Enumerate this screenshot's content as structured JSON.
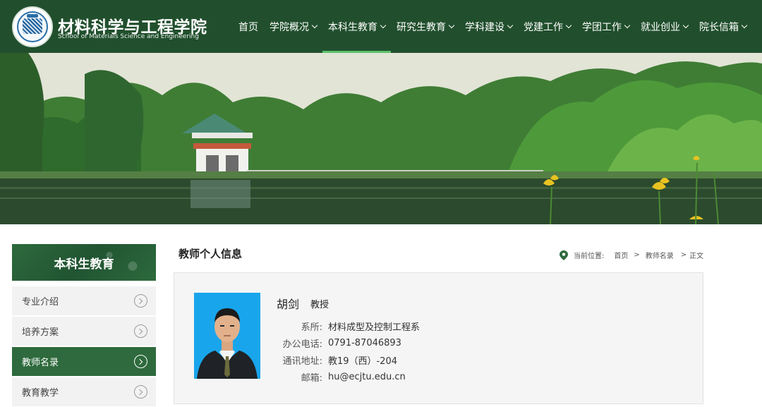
{
  "header": {
    "school_cn": "材料科学与工程学院",
    "school_en": "School of Materials Science and Engineering",
    "nav": [
      {
        "label": "首页",
        "has_dropdown": false,
        "active": false
      },
      {
        "label": "学院概况",
        "has_dropdown": true,
        "active": false
      },
      {
        "label": "本科生教育",
        "has_dropdown": true,
        "active": true
      },
      {
        "label": "研究生教育",
        "has_dropdown": true,
        "active": false
      },
      {
        "label": "学科建设",
        "has_dropdown": true,
        "active": false
      },
      {
        "label": "党建工作",
        "has_dropdown": true,
        "active": false
      },
      {
        "label": "学团工作",
        "has_dropdown": true,
        "active": false
      },
      {
        "label": "就业创业",
        "has_dropdown": true,
        "active": false
      },
      {
        "label": "院长信箱",
        "has_dropdown": true,
        "active": false
      }
    ]
  },
  "sidebar": {
    "title": "本科生教育",
    "items": [
      {
        "label": "专业介绍",
        "active": false
      },
      {
        "label": "培养方案",
        "active": false
      },
      {
        "label": "教师名录",
        "active": true
      },
      {
        "label": "教育教学",
        "active": false
      }
    ]
  },
  "main": {
    "page_title": "教师个人信息",
    "breadcrumb": {
      "prefix": "当前位置:",
      "items": [
        "首页",
        "教师名录",
        "正文"
      ]
    },
    "profile": {
      "name": "胡剑",
      "title": "教授",
      "fields": [
        {
          "label": "系所:",
          "value": "材料成型及控制工程系"
        },
        {
          "label": "办公电话:",
          "value": "0791-87046893"
        },
        {
          "label": "通讯地址:",
          "value": "教19（西）-204"
        },
        {
          "label": "邮箱:",
          "value": "hu@ecjtu.edu.cn"
        }
      ]
    }
  },
  "colors": {
    "header_bg": "#214f2d",
    "accent_green": "#2e6a3d",
    "nav_underline": "#5cc06c",
    "photo_bg": "#19a5ec"
  }
}
